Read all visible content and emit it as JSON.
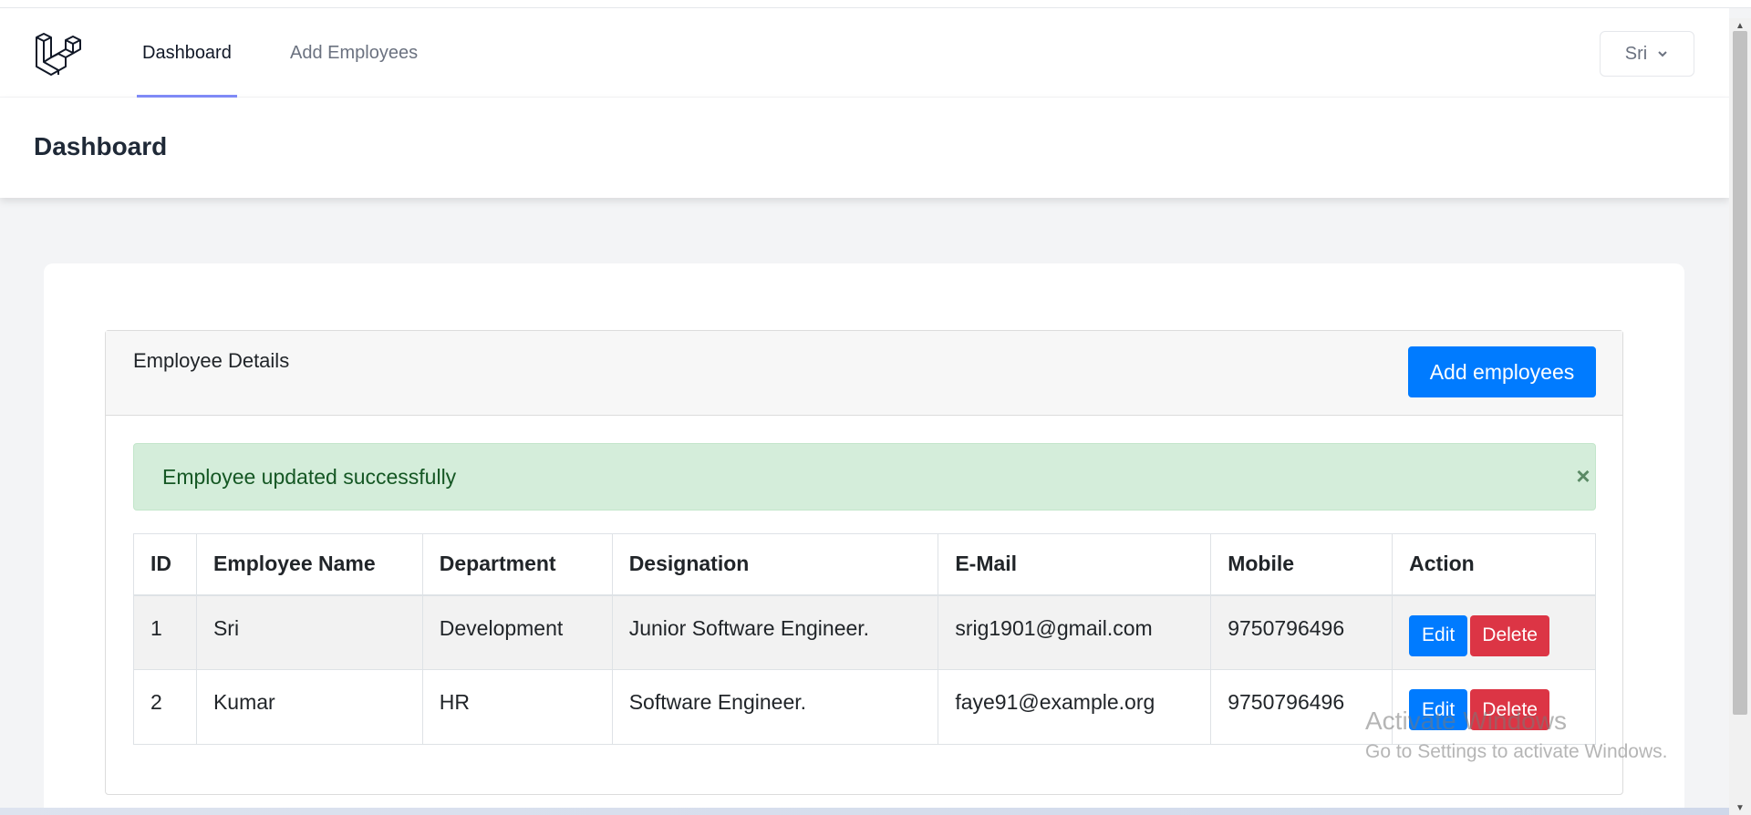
{
  "nav": {
    "logo_icon": "laravel-logo-icon",
    "links": [
      {
        "label": "Dashboard",
        "active": true
      },
      {
        "label": "Add Employees",
        "active": false
      }
    ],
    "user": {
      "name": "Sri",
      "icon": "chevron-down-icon"
    }
  },
  "header": {
    "title": "Dashboard"
  },
  "panel": {
    "title": "Employee Details",
    "add_button_label": "Add employees"
  },
  "alert": {
    "message": "Employee updated successfully",
    "close_label": "×"
  },
  "table": {
    "columns": [
      "ID",
      "Employee Name",
      "Department",
      "Designation",
      "E-Mail",
      "Mobile",
      "Action"
    ],
    "rows": [
      {
        "id": "1",
        "name": "Sri",
        "department": "Development",
        "designation": "Junior Software Engineer.",
        "email": "srig1901@gmail.com",
        "mobile": "9750796496",
        "edit_label": "Edit",
        "delete_label": "Delete"
      },
      {
        "id": "2",
        "name": "Kumar",
        "department": "HR",
        "designation": "Software Engineer.",
        "email": "faye91@example.org",
        "mobile": "9750796496",
        "edit_label": "Edit",
        "delete_label": "Delete"
      }
    ]
  },
  "watermark": {
    "title": "Activate Windows",
    "subtitle": "Go to Settings to activate Windows."
  },
  "colors": {
    "primary": "#007bff",
    "danger": "#dc3545",
    "success_bg": "#d4edda",
    "nav_active_underline": "#818cf8"
  }
}
